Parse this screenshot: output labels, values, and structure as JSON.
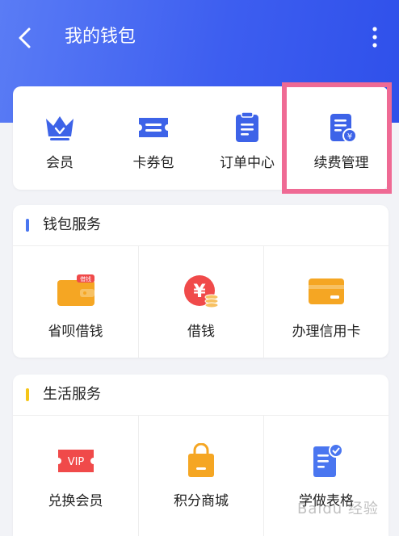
{
  "header": {
    "title": "我的钱包",
    "back_icon": "chevron-left-icon",
    "more_icon": "more-vertical-icon",
    "bg_colors": [
      "#5a7cf5",
      "#2f50ea"
    ]
  },
  "quick_actions": [
    {
      "label": "会员",
      "icon": "crown-icon"
    },
    {
      "label": "卡券包",
      "icon": "ticket-icon"
    },
    {
      "label": "订单中心",
      "icon": "clipboard-icon"
    },
    {
      "label": "续费管理",
      "icon": "renewal-doc-icon",
      "highlighted": true
    }
  ],
  "wallet_services": {
    "title": "钱包服务",
    "accent": "#4a76f0",
    "items": [
      {
        "label": "省呗借钱",
        "icon": "wallet-icon",
        "badge": "借钱"
      },
      {
        "label": "借钱",
        "icon": "yuan-coin-icon",
        "glyph": "¥"
      },
      {
        "label": "办理信用卡",
        "icon": "credit-card-icon"
      }
    ]
  },
  "life_services": {
    "title": "生活服务",
    "accent": "#f5c518",
    "items": [
      {
        "label": "兑换会员",
        "icon": "vip-ticket-icon",
        "glyph": "VIP"
      },
      {
        "label": "积分商城",
        "icon": "shopping-bag-icon"
      },
      {
        "label": "学做表格",
        "icon": "form-check-icon"
      }
    ]
  },
  "highlight_color": "#ef6a94",
  "watermark": "Baidu 经验"
}
